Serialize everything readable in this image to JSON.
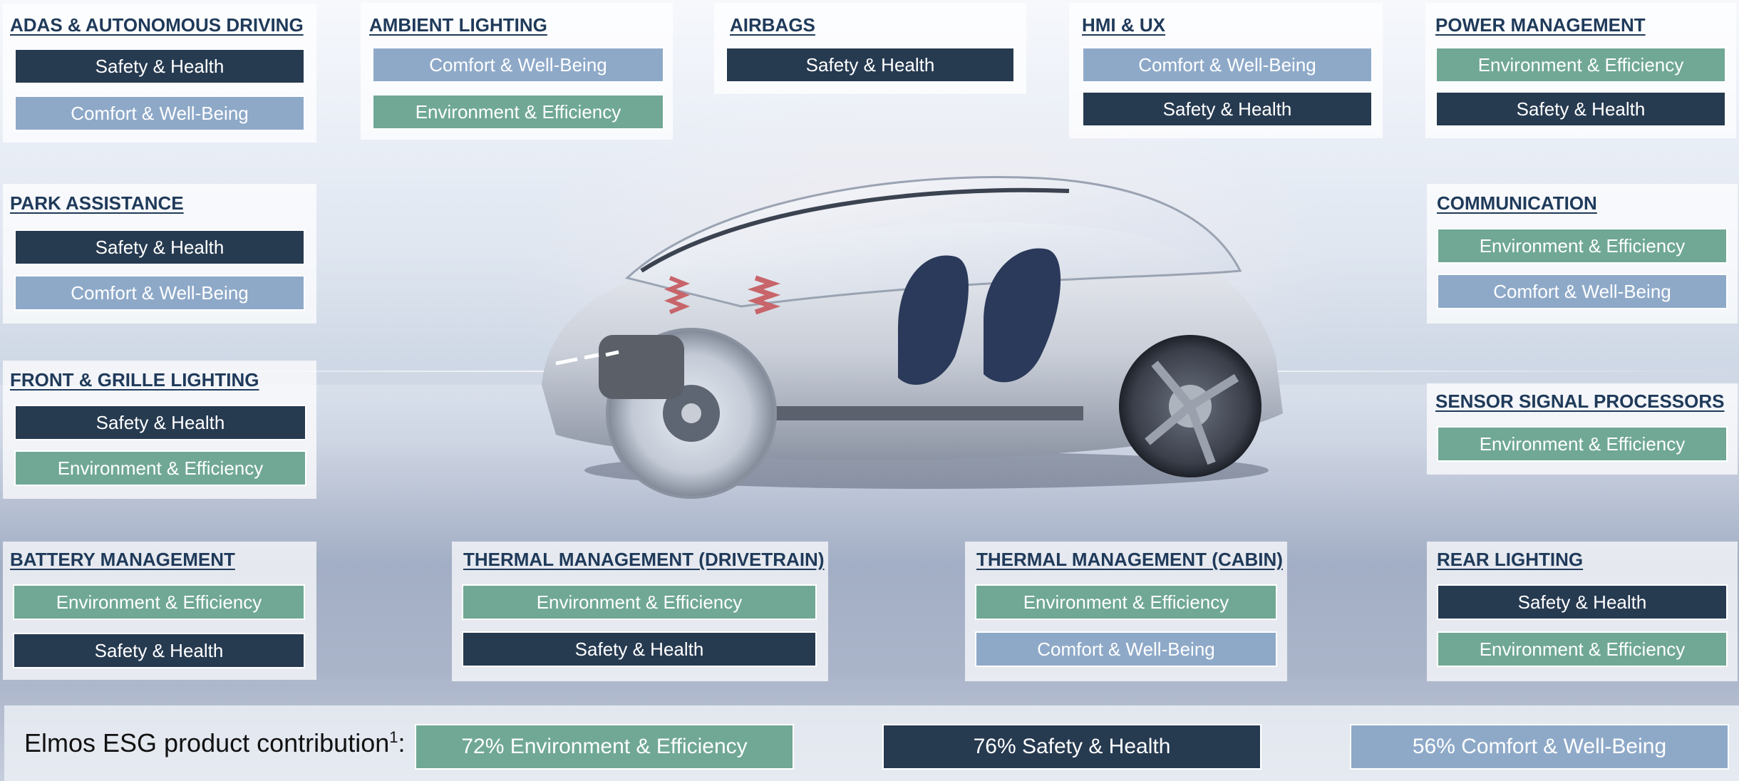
{
  "colors": {
    "safety": "#263a50",
    "comfort": "#8ea9c8",
    "environment": "#70a895",
    "title": "#1f3a5a"
  },
  "panels": [
    {
      "title": "ADAS & AUTONOMOUS DRIVING",
      "tags": [
        "Safety & Health",
        "Comfort & Well-Being"
      ]
    },
    {
      "title": "AMBIENT LIGHTING",
      "tags": [
        "Comfort & Well-Being",
        "Environment & Efficiency"
      ]
    },
    {
      "title": "AIRBAGS",
      "tags": [
        "Safety & Health"
      ]
    },
    {
      "title": "HMI & UX",
      "tags": [
        "Comfort & Well-Being",
        "Safety & Health"
      ]
    },
    {
      "title": "POWER MANAGEMENT",
      "tags": [
        "Environment & Efficiency",
        "Safety & Health"
      ]
    },
    {
      "title": "PARK ASSISTANCE",
      "tags": [
        "Safety & Health",
        "Comfort & Well-Being"
      ]
    },
    {
      "title": "COMMUNICATION",
      "tags": [
        "Environment & Efficiency",
        "Comfort & Well-Being"
      ]
    },
    {
      "title": "FRONT & GRILLE LIGHTING",
      "tags": [
        "Safety & Health",
        "Environment & Efficiency"
      ]
    },
    {
      "title": "SENSOR SIGNAL PROCESSORS",
      "tags": [
        "Environment & Efficiency"
      ]
    },
    {
      "title": "BATTERY MANAGEMENT",
      "tags": [
        "Environment & Efficiency",
        "Safety & Health"
      ]
    },
    {
      "title": "THERMAL MANAGEMENT (DRIVETRAIN)",
      "tags": [
        "Environment & Efficiency",
        "Safety & Health"
      ]
    },
    {
      "title": "THERMAL MANAGEMENT (CABIN)",
      "tags": [
        "Environment & Efficiency",
        "Comfort & Well-Being"
      ]
    },
    {
      "title": "REAR LIGHTING",
      "tags": [
        "Safety & Health",
        "Environment & Efficiency"
      ]
    }
  ],
  "bottom": {
    "label": "Elmos ESG product contribution",
    "footnote": "1",
    "suffix": ":",
    "stats": [
      {
        "text": "72% Environment & Efficiency",
        "percent": 72
      },
      {
        "text": "76% Safety & Health",
        "percent": 76
      },
      {
        "text": "56% Comfort & Well-Being",
        "percent": 56
      }
    ]
  },
  "image": {
    "subject": "concept-car-illustration"
  }
}
